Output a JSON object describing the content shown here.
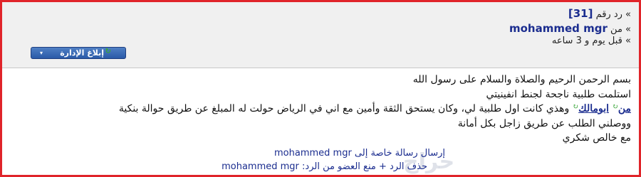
{
  "post": {
    "reply_prefix": "» رد رقم",
    "reply_number": "[31]",
    "from_prefix": "» من",
    "author": "mohammed mgr",
    "time": "» قبل يوم و 3 ساعه"
  },
  "report_button": {
    "label": "إبلاغ الإدارة",
    "caret": "▾"
  },
  "message": {
    "line1": "بسم الرحمن الرحيم والصلاة والسلام على رسول الله",
    "line2": "استلمت طلبية ناجحة لجنط انفينيتي",
    "line3_link1": "من",
    "line3_link2": "ابومالك",
    "line3_rest": "وهذي كانت اول طلبية لي، وكان يستحق الثقة وأمين مع اني في الرياض حولت له المبلغ عن طريق حوالة بنكية",
    "line4": "ووصلني الطلب عن طريق زاجل بكل أمانة",
    "line5": "مع خالص شكري"
  },
  "footer": {
    "pm_link": "إرسال رسالة خاصة إلى mohammed mgr",
    "quote_link": "حذف الرد + منع العضو من الرد: mohammed mgr",
    "watermark": "حراج"
  }
}
